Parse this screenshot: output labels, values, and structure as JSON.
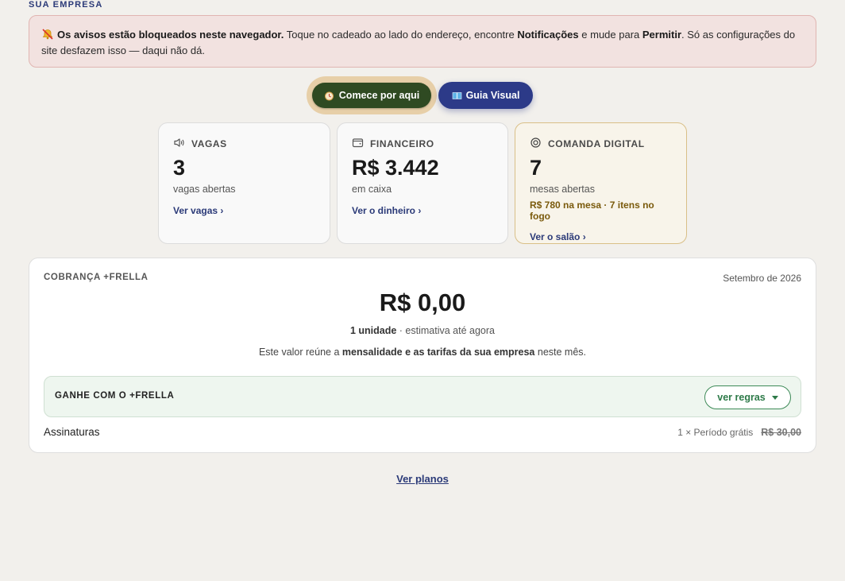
{
  "section_label": "SUA EMPRESA",
  "alert": {
    "bold_lead": "Os avisos estão bloqueados neste navegador.",
    "text1": " Toque no cadeado ao lado do endereço, encontre ",
    "bold_notif": "Notificações",
    "text2": " e mude para ",
    "bold_allow": "Permitir",
    "text3": ". Só as configurações do site desfazem isso — daqui não dá.",
    "icon": "bell-off-icon"
  },
  "cta": {
    "start_label": "Comece por aqui",
    "start_icon": "alarm-clock-icon",
    "guide_label": "Guia Visual",
    "guide_icon": "book-icon"
  },
  "cards": {
    "vagas": {
      "title": "VAGAS",
      "value": "3",
      "sub": "vagas abertas",
      "link": "Ver vagas ›",
      "icon": "speaker-icon"
    },
    "financeiro": {
      "title": "FINANCEIRO",
      "value": "R$ 3.442",
      "sub": "em caixa",
      "link": "Ver o dinheiro ›",
      "icon": "wallet-icon"
    },
    "comanda": {
      "title": "COMANDA DIGITAL",
      "value": "7",
      "sub": "mesas abertas",
      "extra": "R$ 780 na mesa · 7 itens no fogo",
      "link": "Ver o salão ›",
      "icon": "target-icon"
    }
  },
  "billing": {
    "title": "COBRANÇA +FRELLA",
    "period": "Setembro de 2026",
    "amount": "R$ 0,00",
    "units_bold": "1 unidade",
    "units_rest": " · estimativa até agora",
    "desc1": "Este valor reúne a ",
    "desc_bold": "mensalidade e as tarifas da sua empresa",
    "desc2": " neste mês.",
    "earn_label": "GANHE COM O +FRELLA",
    "rules_label": "ver regras",
    "subscriptions": {
      "name": "Assinaturas",
      "detail": "1 × Período grátis",
      "price": "R$ 30,00"
    }
  },
  "plans_link": "Ver planos",
  "colors": {
    "accent_navy": "#2c3a88",
    "start_green": "#2f4a22",
    "alert_bg": "#f2e2e0",
    "earn_green": "#2d7a48"
  }
}
